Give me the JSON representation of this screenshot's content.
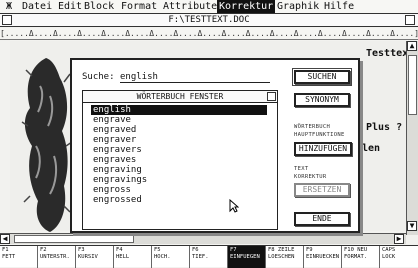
{
  "menubar": {
    "atari_logo": "Ж",
    "items": [
      "Datei",
      "Edit",
      "Block",
      "Format",
      "Attribute",
      "Korrektur",
      "Graphik",
      "Hilfe"
    ]
  },
  "window": {
    "title": "F:\\TESTTEXT.DOC"
  },
  "ruler": {
    "text": "[.....Δ....Δ....Δ....Δ....Δ....Δ....Δ....Δ....Δ....Δ....Δ....Δ....Δ....Δ....Δ....Δ....]"
  },
  "document": {
    "lines": [
      "Testtext",
      "Plus ?",
      "len"
    ]
  },
  "dialog": {
    "search_label": "Suche:",
    "search_value": "english",
    "dictionary": {
      "title": "WÖRTERBUCH FENSTER",
      "items": [
        "english",
        "engrave",
        "engraved",
        "engraver",
        "engravers",
        "engraves",
        "engraving",
        "engravings",
        "engross",
        "engrossed"
      ],
      "selected_index": 0
    },
    "buttons": {
      "suchen": "SUCHEN",
      "synonym": "SYNONYM",
      "hinzufuegen": "HINZUFÜGEN",
      "ersetzen": "ERSETZEN",
      "ende": "ENDE"
    },
    "labels": {
      "woerterbuch": "WÖRTERBUCH",
      "hauptfunktione": "HAUPTFUNKTIONE",
      "text": "TEXT",
      "korrektur": "KORREKTUR"
    }
  },
  "fkeys": [
    {
      "key": "F1",
      "label": "FETT"
    },
    {
      "key": "F2",
      "label": "UNTERSTR."
    },
    {
      "key": "F3",
      "label": "KURSIV"
    },
    {
      "key": "F4",
      "label": "HELL"
    },
    {
      "key": "F5",
      "label": "HOCH."
    },
    {
      "key": "F6",
      "label": "TIEF."
    },
    {
      "key": "F7",
      "label": "EINFUEGEN"
    },
    {
      "key": "F8 ZEILE",
      "label": "LOESCHEN"
    },
    {
      "key": "F9",
      "label": "EINRUECKEN"
    },
    {
      "key": "F10 NEU",
      "label": "FORMAT."
    },
    {
      "key": "CAPS",
      "label": "LOCK"
    }
  ],
  "colors": {
    "selection": "#111111",
    "background": "#ffffff",
    "disabled": "#888888"
  }
}
